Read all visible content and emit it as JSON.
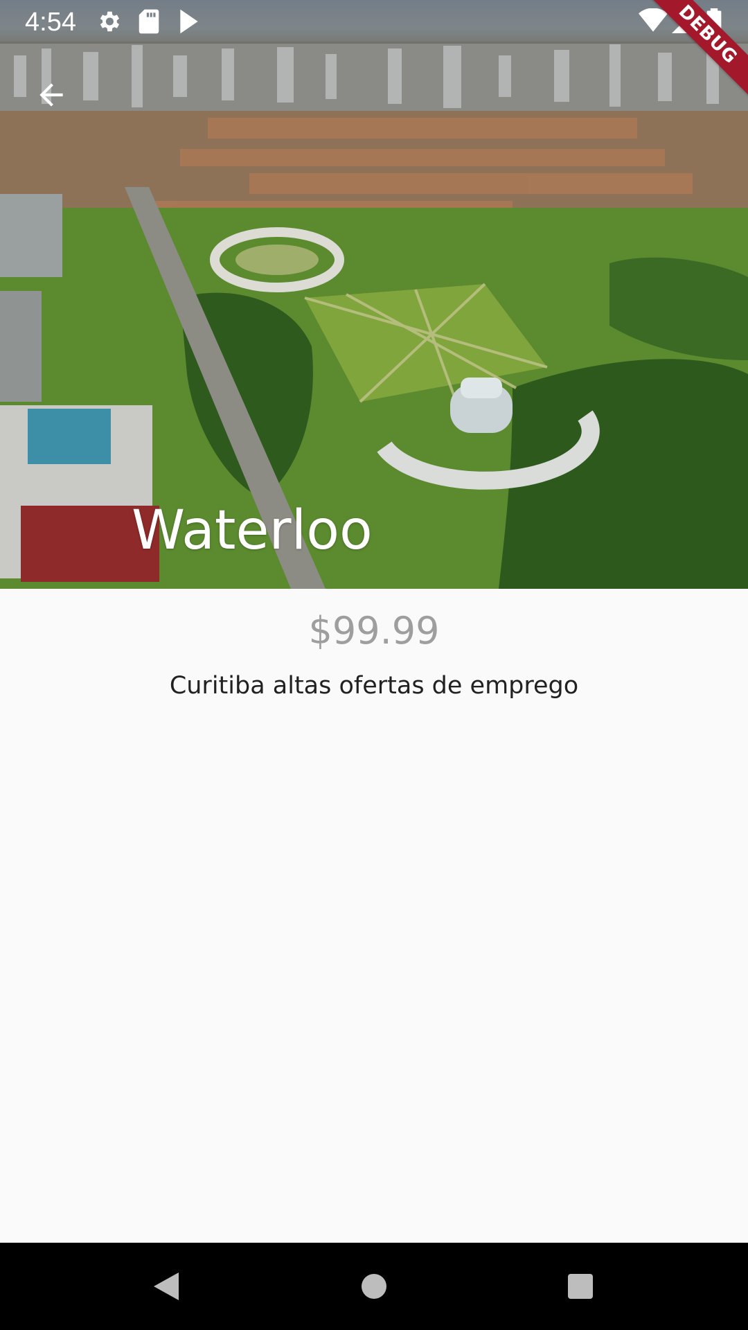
{
  "status_bar": {
    "time": "4:54",
    "icons": [
      "settings-icon",
      "sd-card-icon",
      "play-store-icon",
      "wifi-icon",
      "signal-icon",
      "battery-icon"
    ]
  },
  "debug_banner": {
    "label": "DEBUG",
    "color": "#a3192b"
  },
  "app_bar": {
    "back_icon": "arrow-back-icon"
  },
  "hero": {
    "title": "Waterloo",
    "image": "aerial-city-park-photo"
  },
  "details": {
    "price": "$99.99",
    "description": "Curitiba altas ofertas de emprego"
  },
  "nav_bar": {
    "buttons": [
      "back-triangle-icon",
      "home-circle-icon",
      "recents-square-icon"
    ]
  },
  "colors": {
    "background": "#fafafa",
    "price": "#9e9e9e",
    "description": "#212121",
    "nav_bar": "#000000"
  }
}
